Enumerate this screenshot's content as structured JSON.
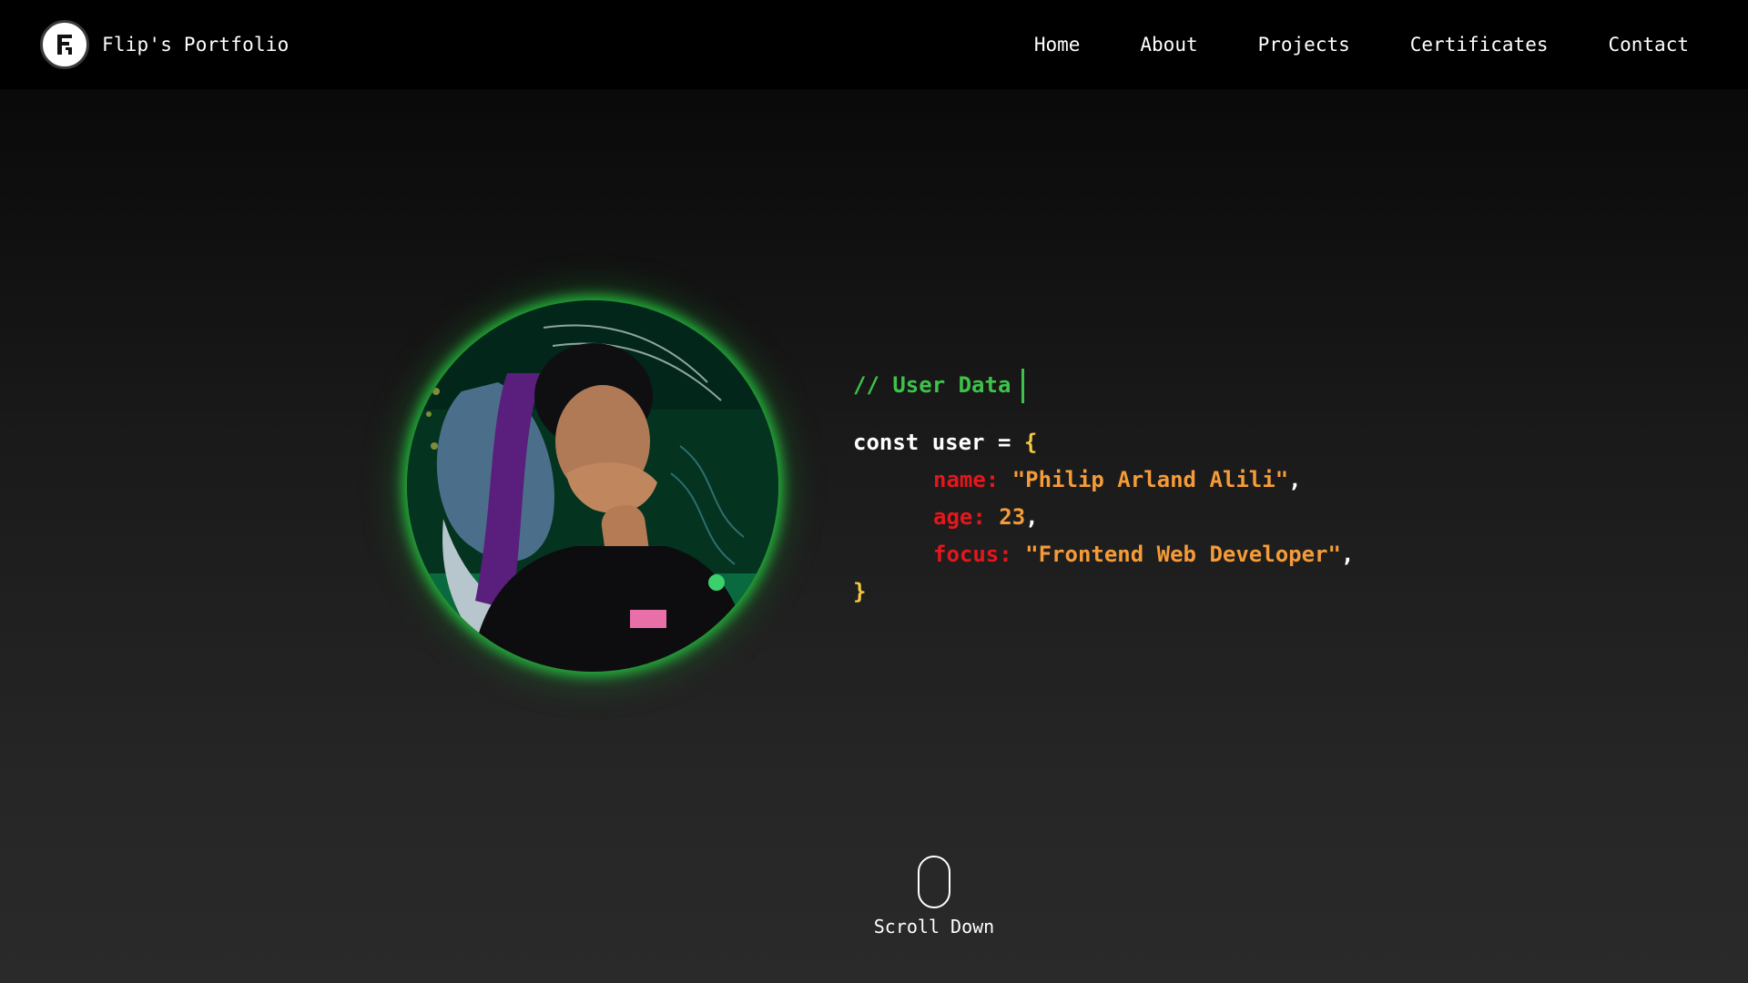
{
  "brand": {
    "name": "Flip's Portfolio",
    "logo_icon": "fp-monogram-icon"
  },
  "nav": {
    "items": [
      {
        "label": "Home"
      },
      {
        "label": "About"
      },
      {
        "label": "Projects"
      },
      {
        "label": "Certificates"
      },
      {
        "label": "Contact"
      }
    ]
  },
  "hero": {
    "avatar_icon": "profile-photo",
    "comment": "// User Data",
    "decl_keyword": "const",
    "decl_name": "user",
    "decl_equals": "=",
    "open_brace": "{",
    "close_brace": "}",
    "fields": [
      {
        "key": "name:",
        "value": "\"Philip Arland Alili\"",
        "sep": ","
      },
      {
        "key": "age:",
        "value": "23",
        "sep": ","
      },
      {
        "key": "focus:",
        "value": "\"Frontend Web Developer\"",
        "sep": ","
      }
    ]
  },
  "scroll": {
    "label": "Scroll Down",
    "icon": "mouse-scroll-icon"
  },
  "colors": {
    "navbar": "#000000",
    "comment": "#3ec34a",
    "brace": "#f5c842",
    "key": "#e3171c",
    "value": "#f59b38",
    "glow": "#28dc46"
  }
}
